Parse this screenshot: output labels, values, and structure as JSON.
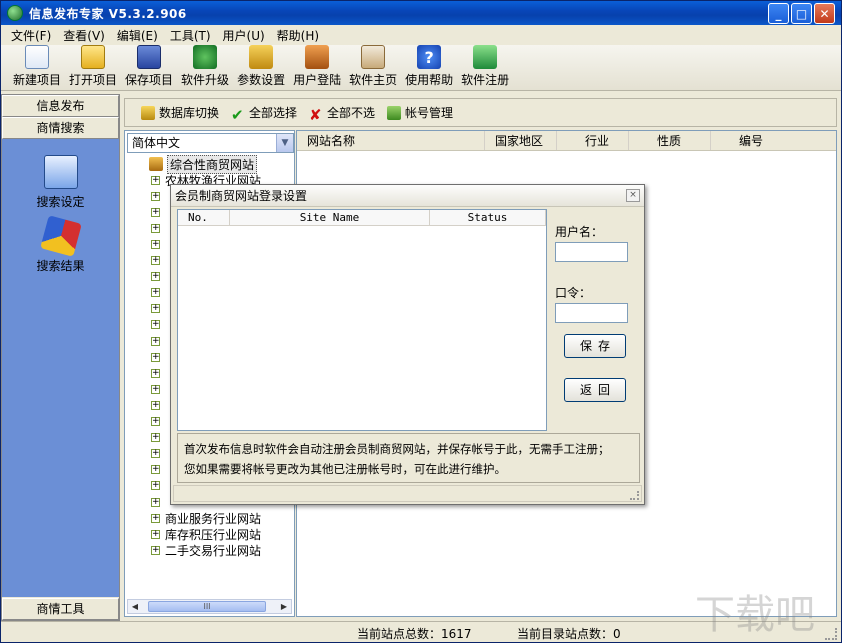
{
  "window": {
    "title": "信息发布专家  V5.3.2.906",
    "buttons": {
      "minimize": "_",
      "maximize": "□",
      "close": "✕"
    }
  },
  "menu": [
    "文件(F)",
    "查看(V)",
    "编辑(E)",
    "工具(T)",
    "用户(U)",
    "帮助(H)"
  ],
  "toolbar": [
    {
      "label": "新建项目",
      "icon": "new-project-icon"
    },
    {
      "label": "打开项目",
      "icon": "open-folder-icon"
    },
    {
      "label": "保存项目",
      "icon": "save-disk-icon"
    },
    {
      "label": "软件升级",
      "icon": "upgrade-globe-icon"
    },
    {
      "label": "参数设置",
      "icon": "settings-icon"
    },
    {
      "label": "用户登陆",
      "icon": "user-login-icon"
    },
    {
      "label": "软件主页",
      "icon": "home-icon"
    },
    {
      "label": "使用帮助",
      "icon": "help-icon"
    },
    {
      "label": "软件注册",
      "icon": "register-icon"
    }
  ],
  "left_panel": {
    "top_buttons": [
      "信息发布",
      "商情搜索"
    ],
    "items": [
      {
        "label": "搜索设定",
        "icon": "search-settings-icon"
      },
      {
        "label": "搜索结果",
        "icon": "search-results-icon"
      }
    ],
    "bottom_button": "商情工具"
  },
  "action_bar": [
    {
      "label": "数据库切换",
      "icon": "database-switch-icon"
    },
    {
      "label": "全部选择",
      "icon": "check-icon"
    },
    {
      "label": "全部不选",
      "icon": "cross-icon"
    },
    {
      "label": "帐号管理",
      "icon": "account-icon"
    }
  ],
  "tree": {
    "language_select": "简体中文",
    "root": "综合性商贸网站",
    "items": [
      "农林牧渔行业网站",
      "",
      "",
      "",
      "",
      "",
      "",
      "",
      "",
      "",
      "",
      "",
      "",
      "",
      "",
      "",
      "",
      "",
      "",
      "",
      "",
      "商业服务行业网站",
      "库存积压行业网站",
      "二手交易行业网站"
    ],
    "scroll_thumb": "III"
  },
  "list": {
    "columns": [
      "网站名称",
      "国家地区",
      "行业",
      "性质",
      "编号"
    ]
  },
  "status": {
    "total_sites": "当前站点总数：1617",
    "dir_sites": "当前目录站点数：0"
  },
  "dialog": {
    "title": "会员制商贸网站登录设置",
    "close": "×",
    "columns": [
      "No.",
      "Site Name",
      "Status"
    ],
    "username_label": "用户名：",
    "password_label": "口令：",
    "save_label": "保存",
    "back_label": "返回",
    "note_line1": "首次发布信息时软件会自动注册会员制商贸网站，并保存帐号于此，无需手工注册；",
    "note_line2": "您如果需要将帐号更改为其他已注册帐号时，可在此进行维护。"
  }
}
